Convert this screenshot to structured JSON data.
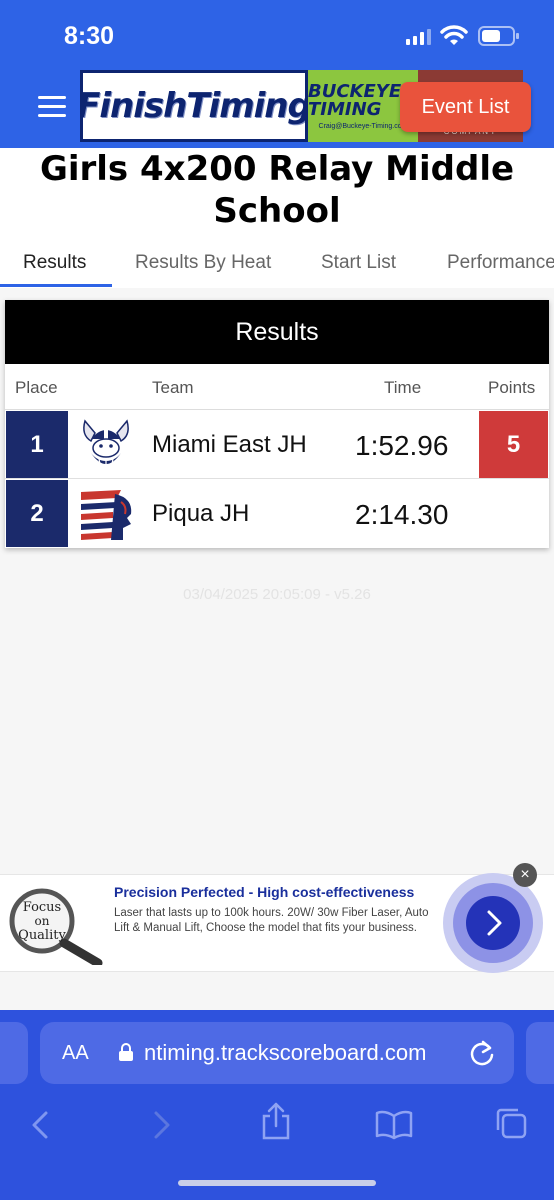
{
  "status_bar": {
    "time": "8:30"
  },
  "header": {
    "logo_text": "FinishTiming",
    "sponsor_logo_text": "BUCKEYE TIMING",
    "sponsor_logo_subtext": "Craig@Buckeye-Timing.com",
    "company_logo_text": "COMPANY",
    "event_list_label": "Event List"
  },
  "page": {
    "title": "Girls 4x200 Relay Middle School",
    "tabs": [
      {
        "label": "Results",
        "active": true
      },
      {
        "label": "Results By Heat",
        "active": false
      },
      {
        "label": "Start List",
        "active": false
      },
      {
        "label": "Performance",
        "active": false
      }
    ]
  },
  "results": {
    "heading": "Results",
    "columns": {
      "place": "Place",
      "team": "Team",
      "time": "Time",
      "points": "Points"
    },
    "rows": [
      {
        "place": "1",
        "team": "Miami East JH",
        "time": "1:52.96",
        "points": "5",
        "logo": "viking-logo"
      },
      {
        "place": "2",
        "team": "Piqua JH",
        "time": "2:14.30",
        "points": "",
        "logo": "indian-head-logo"
      }
    ]
  },
  "footer_timestamp": "03/04/2025 20:05:09 - v5.26",
  "ad": {
    "image_text": "Focus on Quality",
    "title": "Precision Perfected - High cost-effectiveness",
    "body": "Laser that lasts up to 100k hours. 20W/ 30w Fiber Laser, Auto Lift & Manual Lift, Choose the model that fits your business.",
    "close_label": "×"
  },
  "browser": {
    "aa_label": "AA",
    "url": "ntiming.trackscoreboard.com"
  },
  "colors": {
    "brand_blue": "#2e63e6",
    "event_list_red": "#e9533c",
    "place_navy": "#1b2a6b",
    "points_red": "#cf3a3a"
  }
}
